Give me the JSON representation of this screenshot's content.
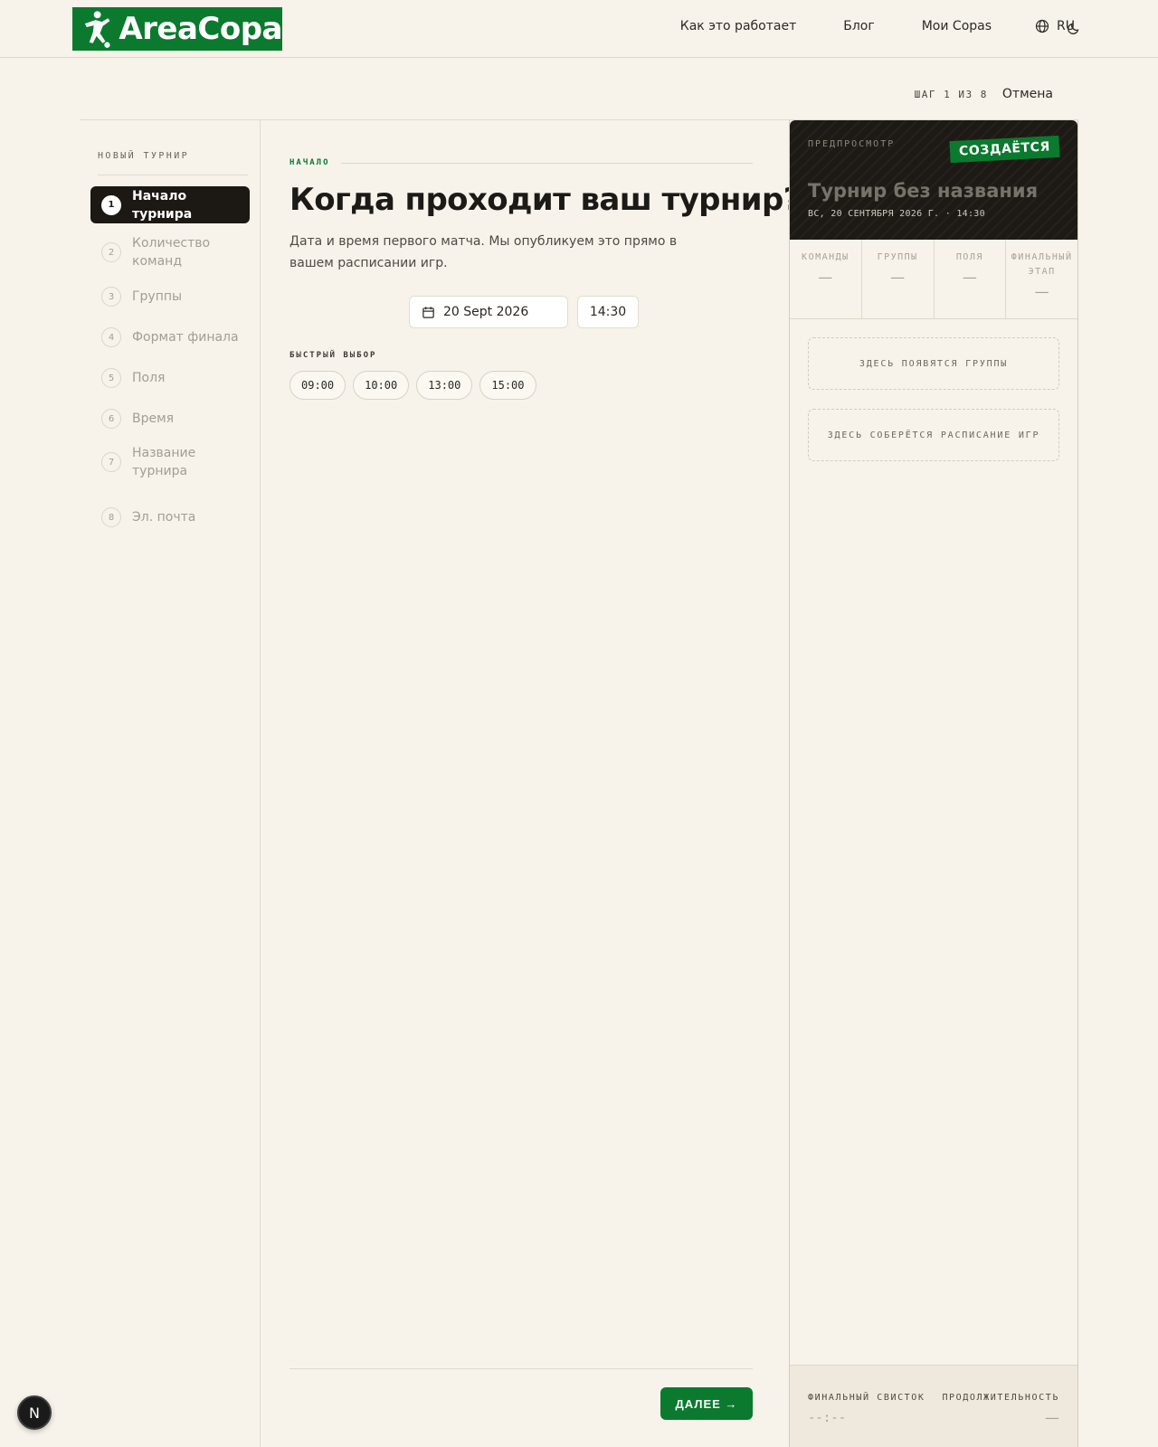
{
  "brand": {
    "name": "AreaCopa"
  },
  "nav": {
    "how_it_works": "Как это работает",
    "blog": "Блог",
    "my_copas": "Мои Copas",
    "language": "RU"
  },
  "stepbar": {
    "counter": "ШАГ 1 ИЗ 8",
    "cancel": "Отмена"
  },
  "sidebar": {
    "title": "НОВЫЙ ТУРНИР",
    "items": [
      {
        "num": "1",
        "label": "Начало турнира",
        "active": true
      },
      {
        "num": "2",
        "label": "Количество команд"
      },
      {
        "num": "3",
        "label": "Группы"
      },
      {
        "num": "4",
        "label": "Формат финала"
      },
      {
        "num": "5",
        "label": "Поля"
      },
      {
        "num": "6",
        "label": "Время"
      },
      {
        "num": "7",
        "label": "Название турнира"
      },
      {
        "num": "8",
        "label": "Эл. почта"
      }
    ]
  },
  "main": {
    "eyebrow": "НАЧАЛО",
    "title": "Когда проходит ваш турнир?",
    "lead": "Дата и время первого матча. Мы опубликуем это прямо в вашем расписании игр.",
    "date_value": "20 Sept 2026",
    "time_value": "14:30",
    "quick_pick_label": "БЫСТРЫЙ ВЫБОР",
    "quick_picks": [
      "09:00",
      "10:00",
      "13:00",
      "15:00"
    ],
    "next_label": "ДАЛЕЕ →"
  },
  "preview": {
    "label": "ПРЕДПРОСМОТР",
    "badge": "СОЗДАЁТСЯ",
    "title": "Турнир без названия",
    "subtitle": "ВС, 20 СЕНТЯБРЯ 2026 Г. · 14:30",
    "stats": [
      {
        "label": "КОМАНДЫ",
        "value": "—"
      },
      {
        "label": "ГРУППЫ",
        "value": "—"
      },
      {
        "label": "ПОЛЯ",
        "value": "—"
      },
      {
        "label": "ФИНАЛЬНЫЙ ЭТАП",
        "value": "—"
      }
    ],
    "groups_placeholder": "ЗДЕСЬ ПОЯВЯТСЯ ГРУППЫ",
    "schedule_placeholder": "ЗДЕСЬ СОБЕРЁТСЯ РАСПИСАНИЕ ИГР",
    "footer": {
      "final_whistle_label": "ФИНАЛЬНЫЙ СВИСТОК",
      "final_whistle_value": "--:--",
      "duration_label": "ПРОДОЛЖИТЕЛЬНОСТЬ",
      "duration_value": "—"
    }
  },
  "devtools_badge": "N"
}
